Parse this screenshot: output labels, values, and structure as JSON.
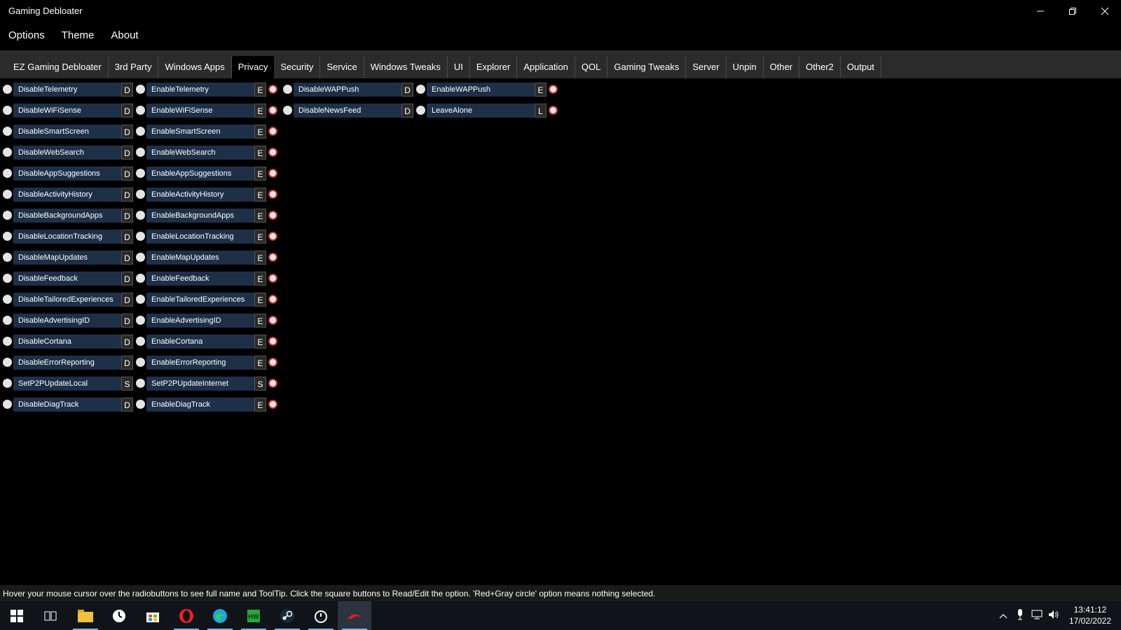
{
  "window": {
    "title": "Gaming Debloater"
  },
  "menu": [
    {
      "label": "Options"
    },
    {
      "label": "Theme"
    },
    {
      "label": "About"
    }
  ],
  "tabs": [
    {
      "label": "EZ Gaming Debloater"
    },
    {
      "label": "3rd Party"
    },
    {
      "label": "Windows Apps"
    },
    {
      "label": "Privacy",
      "active": true
    },
    {
      "label": "Security"
    },
    {
      "label": "Service"
    },
    {
      "label": "Windows Tweaks"
    },
    {
      "label": "UI"
    },
    {
      "label": "Explorer"
    },
    {
      "label": "Application"
    },
    {
      "label": "QOL"
    },
    {
      "label": "Gaming Tweaks"
    },
    {
      "label": "Server"
    },
    {
      "label": "Unpin"
    },
    {
      "label": "Other"
    },
    {
      "label": "Other2"
    },
    {
      "label": "Output"
    }
  ],
  "options": {
    "pair1": [
      {
        "a": "DisableTelemetry",
        "ab": "D",
        "b": "EnableTelemetry",
        "bb": "E"
      },
      {
        "a": "DisableWiFiSense",
        "ab": "D",
        "b": "EnableWiFiSense",
        "bb": "E"
      },
      {
        "a": "DisableSmartScreen",
        "ab": "D",
        "b": "EnableSmartScreen",
        "bb": "E"
      },
      {
        "a": "DisableWebSearch",
        "ab": "D",
        "b": "EnableWebSearch",
        "bb": "E"
      },
      {
        "a": "DisableAppSuggestions",
        "ab": "D",
        "b": "EnableAppSuggestions",
        "bb": "E"
      },
      {
        "a": "DisableActivityHistory",
        "ab": "D",
        "b": "EnableActivityHistory",
        "bb": "E"
      },
      {
        "a": "DisableBackgroundApps",
        "ab": "D",
        "b": "EnableBackgroundApps",
        "bb": "E"
      },
      {
        "a": "DisableLocationTracking",
        "ab": "D",
        "b": "EnableLocationTracking",
        "bb": "E"
      },
      {
        "a": "DisableMapUpdates",
        "ab": "D",
        "b": "EnableMapUpdates",
        "bb": "E"
      },
      {
        "a": "DisableFeedback",
        "ab": "D",
        "b": "EnableFeedback",
        "bb": "E"
      },
      {
        "a": "DisableTailoredExperiences",
        "ab": "D",
        "b": "EnableTailoredExperiences",
        "bb": "E"
      },
      {
        "a": "DisableAdvertisingID",
        "ab": "D",
        "b": "EnableAdvertisingID",
        "bb": "E"
      },
      {
        "a": "DisableCortana",
        "ab": "D",
        "b": "EnableCortana",
        "bb": "E"
      },
      {
        "a": "DisableErrorReporting",
        "ab": "D",
        "b": "EnableErrorReporting",
        "bb": "E"
      },
      {
        "a": "SetP2PUpdateLocal",
        "ab": "S",
        "b": "SetP2PUpdateInternet",
        "bb": "S"
      },
      {
        "a": "DisableDiagTrack",
        "ab": "D",
        "b": "EnableDiagTrack",
        "bb": "E"
      }
    ],
    "pair2": [
      {
        "a": "DisableWAPPush",
        "ab": "D",
        "b": "EnableWAPPush",
        "bb": "E"
      },
      {
        "a": "DisableNewsFeed",
        "ab": "D",
        "b": "LeaveAlone",
        "bb": "L"
      }
    ]
  },
  "status": {
    "text": "Hover your mouse cursor over the radiobuttons to see full name and ToolTip. Click the square buttons to Read/Edit the option. 'Red+Gray circle' option means nothing selected."
  },
  "taskbar": {
    "apps": [
      "start-icon",
      "task-view-icon",
      "file-explorer-icon",
      "clock-app-icon",
      "store-icon",
      "opera-icon",
      "edge-icon",
      "hwinfo-icon",
      "steam-icon",
      "timer-app-icon",
      "debloater-app-icon"
    ],
    "time": "13:41:12",
    "date": "17/02/2022"
  },
  "colors": {
    "label_bg": "#1e3048",
    "tab_strip": "#2b2b2b",
    "unselected_ring": "#c23838"
  }
}
